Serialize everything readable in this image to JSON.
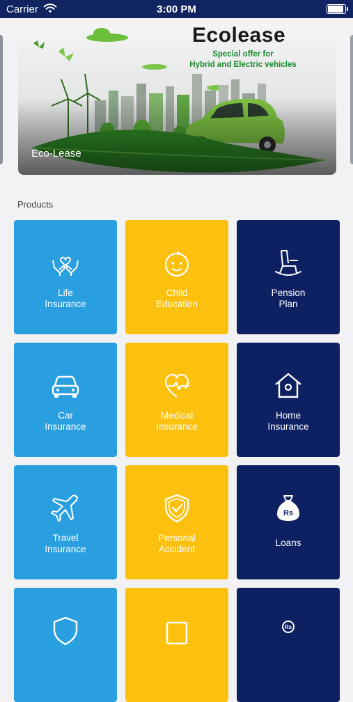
{
  "status_bar": {
    "carrier": "Carrier",
    "time": "3:00 PM",
    "battery_level": 0.9
  },
  "banner": {
    "brand": "Ecolease",
    "offer_line1": "Special offer for",
    "offer_line2": "Hybrid and Electric vehicles",
    "caption": "Eco-Lease"
  },
  "products": {
    "title": "Products",
    "items": [
      {
        "line1": "Life",
        "line2": "Insurance",
        "color": "#2a9fe0",
        "icon": "heart-hands-icon"
      },
      {
        "line1": "Child",
        "line2": "Education",
        "color": "#fcc10f",
        "icon": "baby-face-icon"
      },
      {
        "line1": "Pension",
        "line2": "Plan",
        "color": "#0d2061",
        "icon": "rocking-chair-icon"
      },
      {
        "line1": "Car",
        "line2": "Insurance",
        "color": "#2a9fe0",
        "icon": "car-icon"
      },
      {
        "line1": "Medical",
        "line2": "Insurance",
        "color": "#fcc10f",
        "icon": "heartbeat-icon"
      },
      {
        "line1": "Home",
        "line2": "Insurance",
        "color": "#0d2061",
        "icon": "house-icon"
      },
      {
        "line1": "Travel",
        "line2": "Insurance",
        "color": "#2a9fe0",
        "icon": "airplane-icon"
      },
      {
        "line1": "Personal",
        "line2": "Accident",
        "color": "#fcc10f",
        "icon": "shield-check-icon"
      },
      {
        "line1": "Loans",
        "color": "#0d2061",
        "icon": "money-bag-icon"
      },
      {
        "color": "#2a9fe0",
        "icon": "shield-icon"
      },
      {
        "color": "#fcc10f",
        "icon": "document-icon"
      },
      {
        "color": "#0d2061",
        "icon": "rupee-icon"
      }
    ]
  }
}
